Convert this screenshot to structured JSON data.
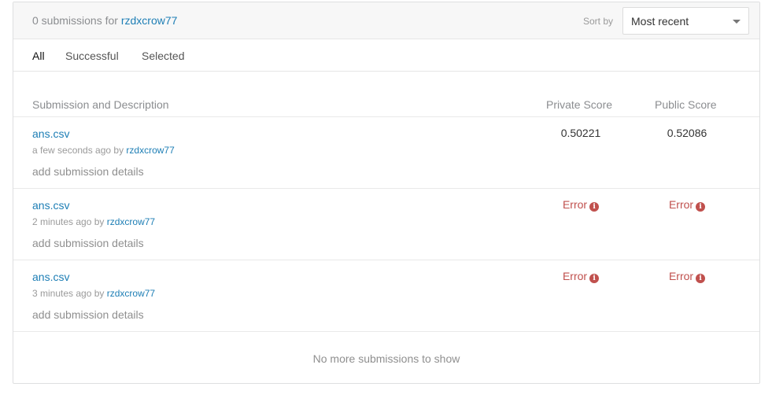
{
  "header": {
    "count_label": "0 submissions for",
    "username": "rzdxcrow77",
    "sort_label": "Sort by",
    "sort_value": "Most recent"
  },
  "tabs": [
    {
      "label": "All",
      "active": true
    },
    {
      "label": "Successful",
      "active": false
    },
    {
      "label": "Selected",
      "active": false
    }
  ],
  "columns": {
    "submission": "Submission and Description",
    "private": "Private Score",
    "public": "Public Score"
  },
  "rows": [
    {
      "file": "ans.csv",
      "time": "a few seconds ago by",
      "user": "rzdxcrow77",
      "details": "add submission details",
      "private": "0.50221",
      "public": "0.52086"
    },
    {
      "file": "ans.csv",
      "time": "2 minutes ago by",
      "user": "rzdxcrow77",
      "details": "add submission details",
      "private": "Error",
      "public": "Error"
    },
    {
      "file": "ans.csv",
      "time": "3 minutes ago by",
      "user": "rzdxcrow77",
      "details": "add submission details",
      "private": "Error",
      "public": "Error"
    }
  ],
  "footer": "No more submissions to show",
  "colors": {
    "link": "#1d7eb5",
    "error": "#c0504d"
  }
}
